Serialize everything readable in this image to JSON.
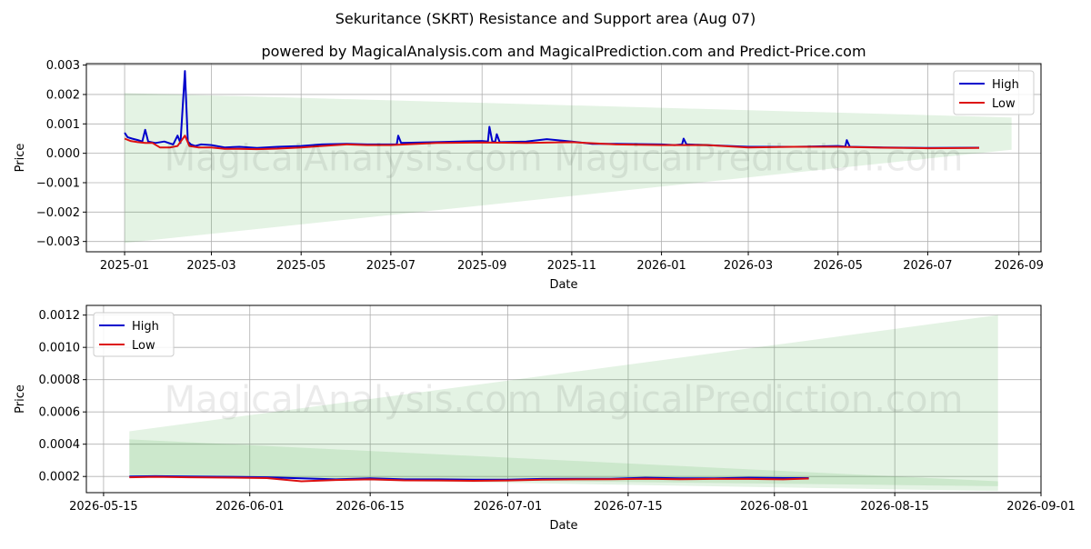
{
  "title": "Sekuritance (SKRT) Resistance and Support area (Aug 07)",
  "watermark": "MagicalAnalysis.com    MagicalPrediction.com",
  "colors": {
    "high": "#0000cc",
    "low": "#dd1111",
    "band": "#2ca02c",
    "grid": "#b0b0b0"
  },
  "chart_data": [
    {
      "type": "line",
      "title": "powered by MagicalAnalysis.com and MagicalPrediction.com and Predict-Price.com",
      "xlabel": "Date",
      "ylabel": "Price",
      "xlim": [
        "2024-12-06",
        "2026-09-16"
      ],
      "ylim": [
        -0.00335,
        0.00305
      ],
      "x_ticks": [
        "2025-01-01",
        "2025-03-01",
        "2025-05-01",
        "2025-07-01",
        "2025-09-01",
        "2025-11-01",
        "2026-01-01",
        "2026-03-01",
        "2026-05-01",
        "2026-07-01",
        "2026-09-01"
      ],
      "x_tick_labels": [
        "2025-01",
        "2025-03",
        "2025-05",
        "2025-07",
        "2025-09",
        "2025-11",
        "2026-01",
        "2026-03",
        "2026-05",
        "2026-07",
        "2026-09"
      ],
      "y_ticks": [
        -0.003,
        -0.002,
        -0.001,
        0.0,
        0.001,
        0.002,
        0.003
      ],
      "y_tick_labels": [
        "−0.003",
        "−0.002",
        "−0.001",
        "0.000",
        "0.001",
        "0.002",
        "0.003"
      ],
      "grid": true,
      "legend_position": "upper-right",
      "bands": [
        {
          "x": [
            "2025-01-01",
            "2026-08-27"
          ],
          "upper": [
            0.00205,
            0.00122
          ],
          "lower": [
            -0.00305,
            0.00012
          ]
        }
      ],
      "series": [
        {
          "name": "High",
          "x": [
            "2025-01-01",
            "2025-01-03",
            "2025-01-06",
            "2025-01-10",
            "2025-01-13",
            "2025-01-15",
            "2025-01-17",
            "2025-01-22",
            "2025-01-28",
            "2025-02-03",
            "2025-02-06",
            "2025-02-08",
            "2025-02-11",
            "2025-02-13",
            "2025-02-15",
            "2025-02-18",
            "2025-02-22",
            "2025-03-01",
            "2025-03-10",
            "2025-03-20",
            "2025-04-01",
            "2025-04-15",
            "2025-05-01",
            "2025-05-15",
            "2025-06-01",
            "2025-06-15",
            "2025-07-01",
            "2025-07-05",
            "2025-07-06",
            "2025-07-08",
            "2025-08-01",
            "2025-09-01",
            "2025-09-05",
            "2025-09-06",
            "2025-09-08",
            "2025-09-10",
            "2025-09-11",
            "2025-09-13",
            "2025-10-01",
            "2025-10-15",
            "2025-11-01",
            "2025-11-15",
            "2025-12-01",
            "2026-01-01",
            "2026-01-10",
            "2026-01-15",
            "2026-01-16",
            "2026-01-18",
            "2026-02-01",
            "2026-03-01",
            "2026-04-01",
            "2026-05-01",
            "2026-05-06",
            "2026-05-07",
            "2026-05-09",
            "2026-06-01",
            "2026-07-01",
            "2026-08-05"
          ],
          "values": [
            0.0007,
            0.00055,
            0.0005,
            0.00045,
            0.0004,
            0.0008,
            0.0004,
            0.00035,
            0.0004,
            0.0003,
            0.0006,
            0.00035,
            0.0028,
            0.0004,
            0.0003,
            0.00025,
            0.0003,
            0.00028,
            0.0002,
            0.00022,
            0.00018,
            0.00022,
            0.00025,
            0.0003,
            0.00032,
            0.0003,
            0.0003,
            0.0003,
            0.0006,
            0.00035,
            0.00038,
            0.00042,
            0.0004,
            0.0009,
            0.0004,
            0.0004,
            0.00065,
            0.00038,
            0.0004,
            0.00048,
            0.0004,
            0.00032,
            0.00032,
            0.0003,
            0.00028,
            0.0003,
            0.0005,
            0.0003,
            0.00028,
            0.00022,
            0.00022,
            0.00025,
            0.00023,
            0.00045,
            0.00022,
            0.0002,
            0.00018,
            0.00019
          ]
        },
        {
          "name": "Low",
          "x": [
            "2025-01-01",
            "2025-01-05",
            "2025-01-10",
            "2025-01-15",
            "2025-01-20",
            "2025-01-25",
            "2025-02-01",
            "2025-02-06",
            "2025-02-11",
            "2025-02-14",
            "2025-02-20",
            "2025-03-01",
            "2025-03-10",
            "2025-03-20",
            "2025-04-01",
            "2025-04-15",
            "2025-05-01",
            "2025-05-15",
            "2025-06-01",
            "2025-06-15",
            "2025-07-01",
            "2025-08-01",
            "2025-09-01",
            "2025-10-01",
            "2025-11-01",
            "2025-12-01",
            "2026-01-01",
            "2026-02-01",
            "2026-03-01",
            "2026-04-01",
            "2026-05-01",
            "2026-06-01",
            "2026-07-01",
            "2026-08-05"
          ],
          "values": [
            0.0005,
            0.00042,
            0.00038,
            0.00035,
            0.00035,
            0.0002,
            0.0002,
            0.00025,
            0.0006,
            0.00025,
            0.0002,
            0.0002,
            0.00015,
            0.00015,
            0.00014,
            0.00016,
            0.0002,
            0.00025,
            0.0003,
            0.00028,
            0.00028,
            0.00035,
            0.00037,
            0.00035,
            0.00038,
            0.0003,
            0.00028,
            0.00028,
            0.0002,
            0.00022,
            0.00022,
            0.00019,
            0.00017,
            0.00018
          ]
        }
      ]
    },
    {
      "type": "line",
      "title": "",
      "xlabel": "Date",
      "ylabel": "Price",
      "xlim": [
        "2026-05-13",
        "2026-09-01"
      ],
      "ylim": [
        9.98e-05,
        0.00126
      ],
      "x_ticks": [
        "2026-05-15",
        "2026-06-01",
        "2026-06-15",
        "2026-07-01",
        "2026-07-15",
        "2026-08-01",
        "2026-08-15",
        "2026-09-01"
      ],
      "x_tick_labels": [
        "2026-05-15",
        "2026-06-01",
        "2026-06-15",
        "2026-07-01",
        "2026-07-15",
        "2026-08-01",
        "2026-08-15",
        "2026-09-01"
      ],
      "y_ticks": [
        0.0002,
        0.0004,
        0.0006,
        0.0008,
        0.001,
        0.0012
      ],
      "y_tick_labels": [
        "0.0002",
        "0.0004",
        "0.0006",
        "0.0008",
        "0.0010",
        "0.0012"
      ],
      "grid": true,
      "legend_position": "upper-left",
      "bands": [
        {
          "x": [
            "2026-05-18",
            "2026-08-27"
          ],
          "upper": [
            0.00048,
            0.0012
          ],
          "lower": [
            0.0002,
            0.00011
          ]
        },
        {
          "x": [
            "2026-05-18",
            "2026-08-27"
          ],
          "upper": [
            0.00043,
            0.00017
          ],
          "lower": [
            0.0002,
            0.00014
          ]
        }
      ],
      "series": [
        {
          "name": "High",
          "x": [
            "2026-05-18",
            "2026-05-21",
            "2026-05-25",
            "2026-05-30",
            "2026-06-03",
            "2026-06-07",
            "2026-06-11",
            "2026-06-15",
            "2026-06-19",
            "2026-06-23",
            "2026-06-27",
            "2026-07-01",
            "2026-07-05",
            "2026-07-09",
            "2026-07-13",
            "2026-07-17",
            "2026-07-21",
            "2026-07-25",
            "2026-07-29",
            "2026-08-02",
            "2026-08-05"
          ],
          "values": [
            0.0002,
            0.000202,
            0.0002,
            0.000198,
            0.000195,
            0.000188,
            0.000182,
            0.000188,
            0.000182,
            0.000182,
            0.00018,
            0.00018,
            0.000185,
            0.000186,
            0.000186,
            0.000192,
            0.000188,
            0.000188,
            0.000192,
            0.00019,
            0.00019
          ]
        },
        {
          "name": "Low",
          "x": [
            "2026-05-18",
            "2026-05-21",
            "2026-05-25",
            "2026-05-30",
            "2026-06-03",
            "2026-06-07",
            "2026-06-11",
            "2026-06-15",
            "2026-06-19",
            "2026-06-23",
            "2026-06-27",
            "2026-07-01",
            "2026-07-05",
            "2026-07-09",
            "2026-07-13",
            "2026-07-17",
            "2026-07-21",
            "2026-07-25",
            "2026-07-29",
            "2026-08-02",
            "2026-08-05"
          ],
          "values": [
            0.000195,
            0.000198,
            0.000195,
            0.000193,
            0.00019,
            0.00017,
            0.000178,
            0.000182,
            0.000176,
            0.000175,
            0.000173,
            0.000175,
            0.00018,
            0.000182,
            0.000183,
            0.000186,
            0.000183,
            0.000185,
            0.000185,
            0.000182,
            0.000187
          ]
        }
      ]
    }
  ]
}
